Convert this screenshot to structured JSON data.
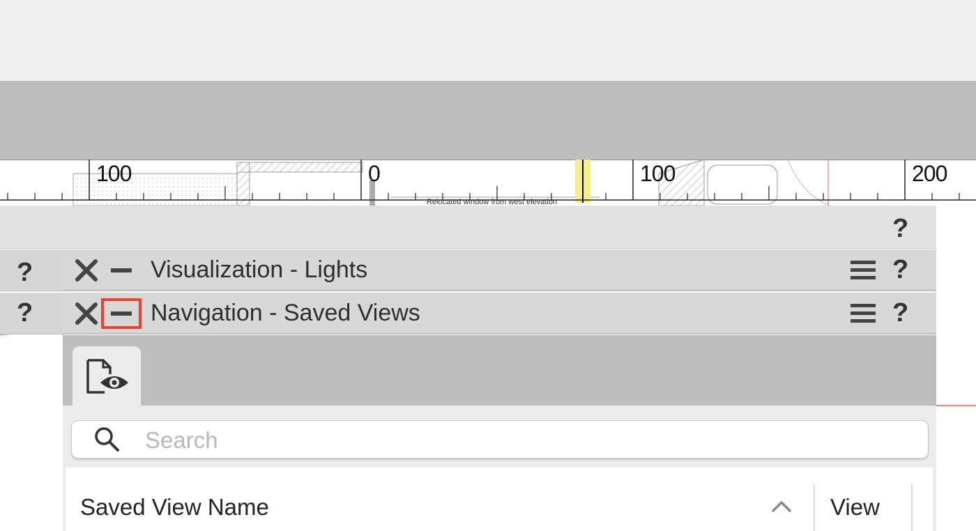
{
  "ruler": {
    "labels": [
      "100",
      "0",
      "100",
      "200"
    ],
    "annotation": "Relocated window from west elevation"
  },
  "panels": [
    {
      "title": "Visualization - Lights"
    },
    {
      "title": "Navigation - Saved Views"
    }
  ],
  "help_glyph": "?",
  "tab": {
    "icon": "saved-view-eye-icon"
  },
  "search": {
    "placeholder": "Search"
  },
  "table": {
    "columns": [
      "Saved View Name",
      "View"
    ],
    "sort": "ascending"
  },
  "colors": {
    "highlight": "#e8432e",
    "panel_gray": "#bebebe",
    "ruler_marker": "#f5f08a",
    "guide_line": "#e06060"
  }
}
